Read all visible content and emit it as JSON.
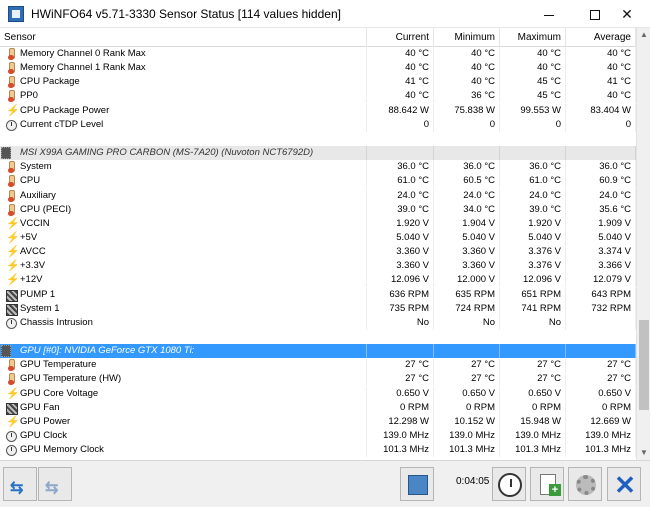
{
  "window": {
    "title": "HWiNFO64 v5.71-3330 Sensor Status [114 values hidden]",
    "minimize_label": "",
    "close_label": "✕"
  },
  "columns": [
    "Sensor",
    "Current",
    "Minimum",
    "Maximum",
    "Average"
  ],
  "rows": [
    {
      "type": "sensor",
      "icon": "thermometer-icon",
      "name": "Memory Channel 0 Rank Max",
      "current": "40 °C",
      "min": "40 °C",
      "max": "40 °C",
      "avg": "40 °C"
    },
    {
      "type": "sensor",
      "icon": "thermometer-icon",
      "name": "Memory Channel 1 Rank Max",
      "current": "40 °C",
      "min": "40 °C",
      "max": "40 °C",
      "avg": "40 °C"
    },
    {
      "type": "sensor",
      "icon": "thermometer-icon",
      "name": "CPU Package",
      "current": "41 °C",
      "min": "40 °C",
      "max": "45 °C",
      "avg": "41 °C"
    },
    {
      "type": "sensor",
      "icon": "thermometer-icon",
      "name": "PP0",
      "current": "40 °C",
      "min": "36 °C",
      "max": "45 °C",
      "avg": "40 °C"
    },
    {
      "type": "sensor",
      "icon": "lightning-icon",
      "name": "CPU Package Power",
      "current": "88.642 W",
      "min": "75.838 W",
      "max": "99.553 W",
      "avg": "83.404 W"
    },
    {
      "type": "sensor",
      "icon": "clock-icon",
      "name": "Current cTDP Level",
      "current": "0",
      "min": "0",
      "max": "0",
      "avg": "0"
    },
    {
      "type": "blank"
    },
    {
      "type": "group",
      "icon": "chip-icon",
      "name": "MSI X99A GAMING PRO CARBON (MS-7A20) (Nuvoton NCT6792D)",
      "selected": false
    },
    {
      "type": "sensor",
      "icon": "thermometer-icon",
      "name": "System",
      "current": "36.0 °C",
      "min": "36.0 °C",
      "max": "36.0 °C",
      "avg": "36.0 °C"
    },
    {
      "type": "sensor",
      "icon": "thermometer-icon",
      "name": "CPU",
      "current": "61.0 °C",
      "min": "60.5 °C",
      "max": "61.0 °C",
      "avg": "60.9 °C"
    },
    {
      "type": "sensor",
      "icon": "thermometer-icon",
      "name": "Auxiliary",
      "current": "24.0 °C",
      "min": "24.0 °C",
      "max": "24.0 °C",
      "avg": "24.0 °C"
    },
    {
      "type": "sensor",
      "icon": "thermometer-icon",
      "name": "CPU (PECI)",
      "current": "39.0 °C",
      "min": "34.0 °C",
      "max": "39.0 °C",
      "avg": "35.6 °C"
    },
    {
      "type": "sensor",
      "icon": "lightning-icon",
      "name": "VCCIN",
      "current": "1.920 V",
      "min": "1.904 V",
      "max": "1.920 V",
      "avg": "1.909 V"
    },
    {
      "type": "sensor",
      "icon": "lightning-icon",
      "name": "+5V",
      "current": "5.040 V",
      "min": "5.040 V",
      "max": "5.040 V",
      "avg": "5.040 V"
    },
    {
      "type": "sensor",
      "icon": "lightning-icon",
      "name": "AVCC",
      "current": "3.360 V",
      "min": "3.360 V",
      "max": "3.376 V",
      "avg": "3.374 V"
    },
    {
      "type": "sensor",
      "icon": "lightning-icon",
      "name": "+3.3V",
      "current": "3.360 V",
      "min": "3.360 V",
      "max": "3.376 V",
      "avg": "3.366 V"
    },
    {
      "type": "sensor",
      "icon": "lightning-icon",
      "name": "+12V",
      "current": "12.096 V",
      "min": "12.000 V",
      "max": "12.096 V",
      "avg": "12.079 V"
    },
    {
      "type": "sensor",
      "icon": "fan-icon",
      "name": "PUMP 1",
      "current": "636 RPM",
      "min": "635 RPM",
      "max": "651 RPM",
      "avg": "643 RPM"
    },
    {
      "type": "sensor",
      "icon": "fan-icon",
      "name": "System 1",
      "current": "735 RPM",
      "min": "724 RPM",
      "max": "741 RPM",
      "avg": "732 RPM"
    },
    {
      "type": "sensor",
      "icon": "clock-icon",
      "name": "Chassis Intrusion",
      "current": "No",
      "min": "No",
      "max": "No",
      "avg": ""
    },
    {
      "type": "blank"
    },
    {
      "type": "group",
      "icon": "chip-icon",
      "name": "GPU [#0]: NVIDIA GeForce GTX 1080 Ti:",
      "selected": true
    },
    {
      "type": "sensor",
      "icon": "thermometer-icon",
      "name": "GPU Temperature",
      "current": "27 °C",
      "min": "27 °C",
      "max": "27 °C",
      "avg": "27 °C"
    },
    {
      "type": "sensor",
      "icon": "thermometer-icon",
      "name": "GPU Temperature (HW)",
      "current": "27 °C",
      "min": "27 °C",
      "max": "27 °C",
      "avg": "27 °C"
    },
    {
      "type": "sensor",
      "icon": "lightning-icon",
      "name": "GPU Core Voltage",
      "current": "0.650 V",
      "min": "0.650 V",
      "max": "0.650 V",
      "avg": "0.650 V"
    },
    {
      "type": "sensor",
      "icon": "fan-icon",
      "name": "GPU Fan",
      "current": "0 RPM",
      "min": "0 RPM",
      "max": "0 RPM",
      "avg": "0 RPM"
    },
    {
      "type": "sensor",
      "icon": "lightning-icon",
      "name": "GPU Power",
      "current": "12.298 W",
      "min": "10.152 W",
      "max": "15.948 W",
      "avg": "12.669 W"
    },
    {
      "type": "sensor",
      "icon": "clock-icon",
      "name": "GPU Clock",
      "current": "139.0 MHz",
      "min": "139.0 MHz",
      "max": "139.0 MHz",
      "avg": "139.0 MHz"
    },
    {
      "type": "sensor",
      "icon": "clock-icon",
      "name": "GPU Memory Clock",
      "current": "101.3 MHz",
      "min": "101.3 MHz",
      "max": "101.3 MHz",
      "avg": "101.3 MHz"
    }
  ],
  "statusbar": {
    "elapsed_time": "0:04:05"
  },
  "colors": {
    "selection": "#3399ff",
    "group_bg": "#e8e8e8",
    "accent_blue": "#1f5fbf"
  }
}
